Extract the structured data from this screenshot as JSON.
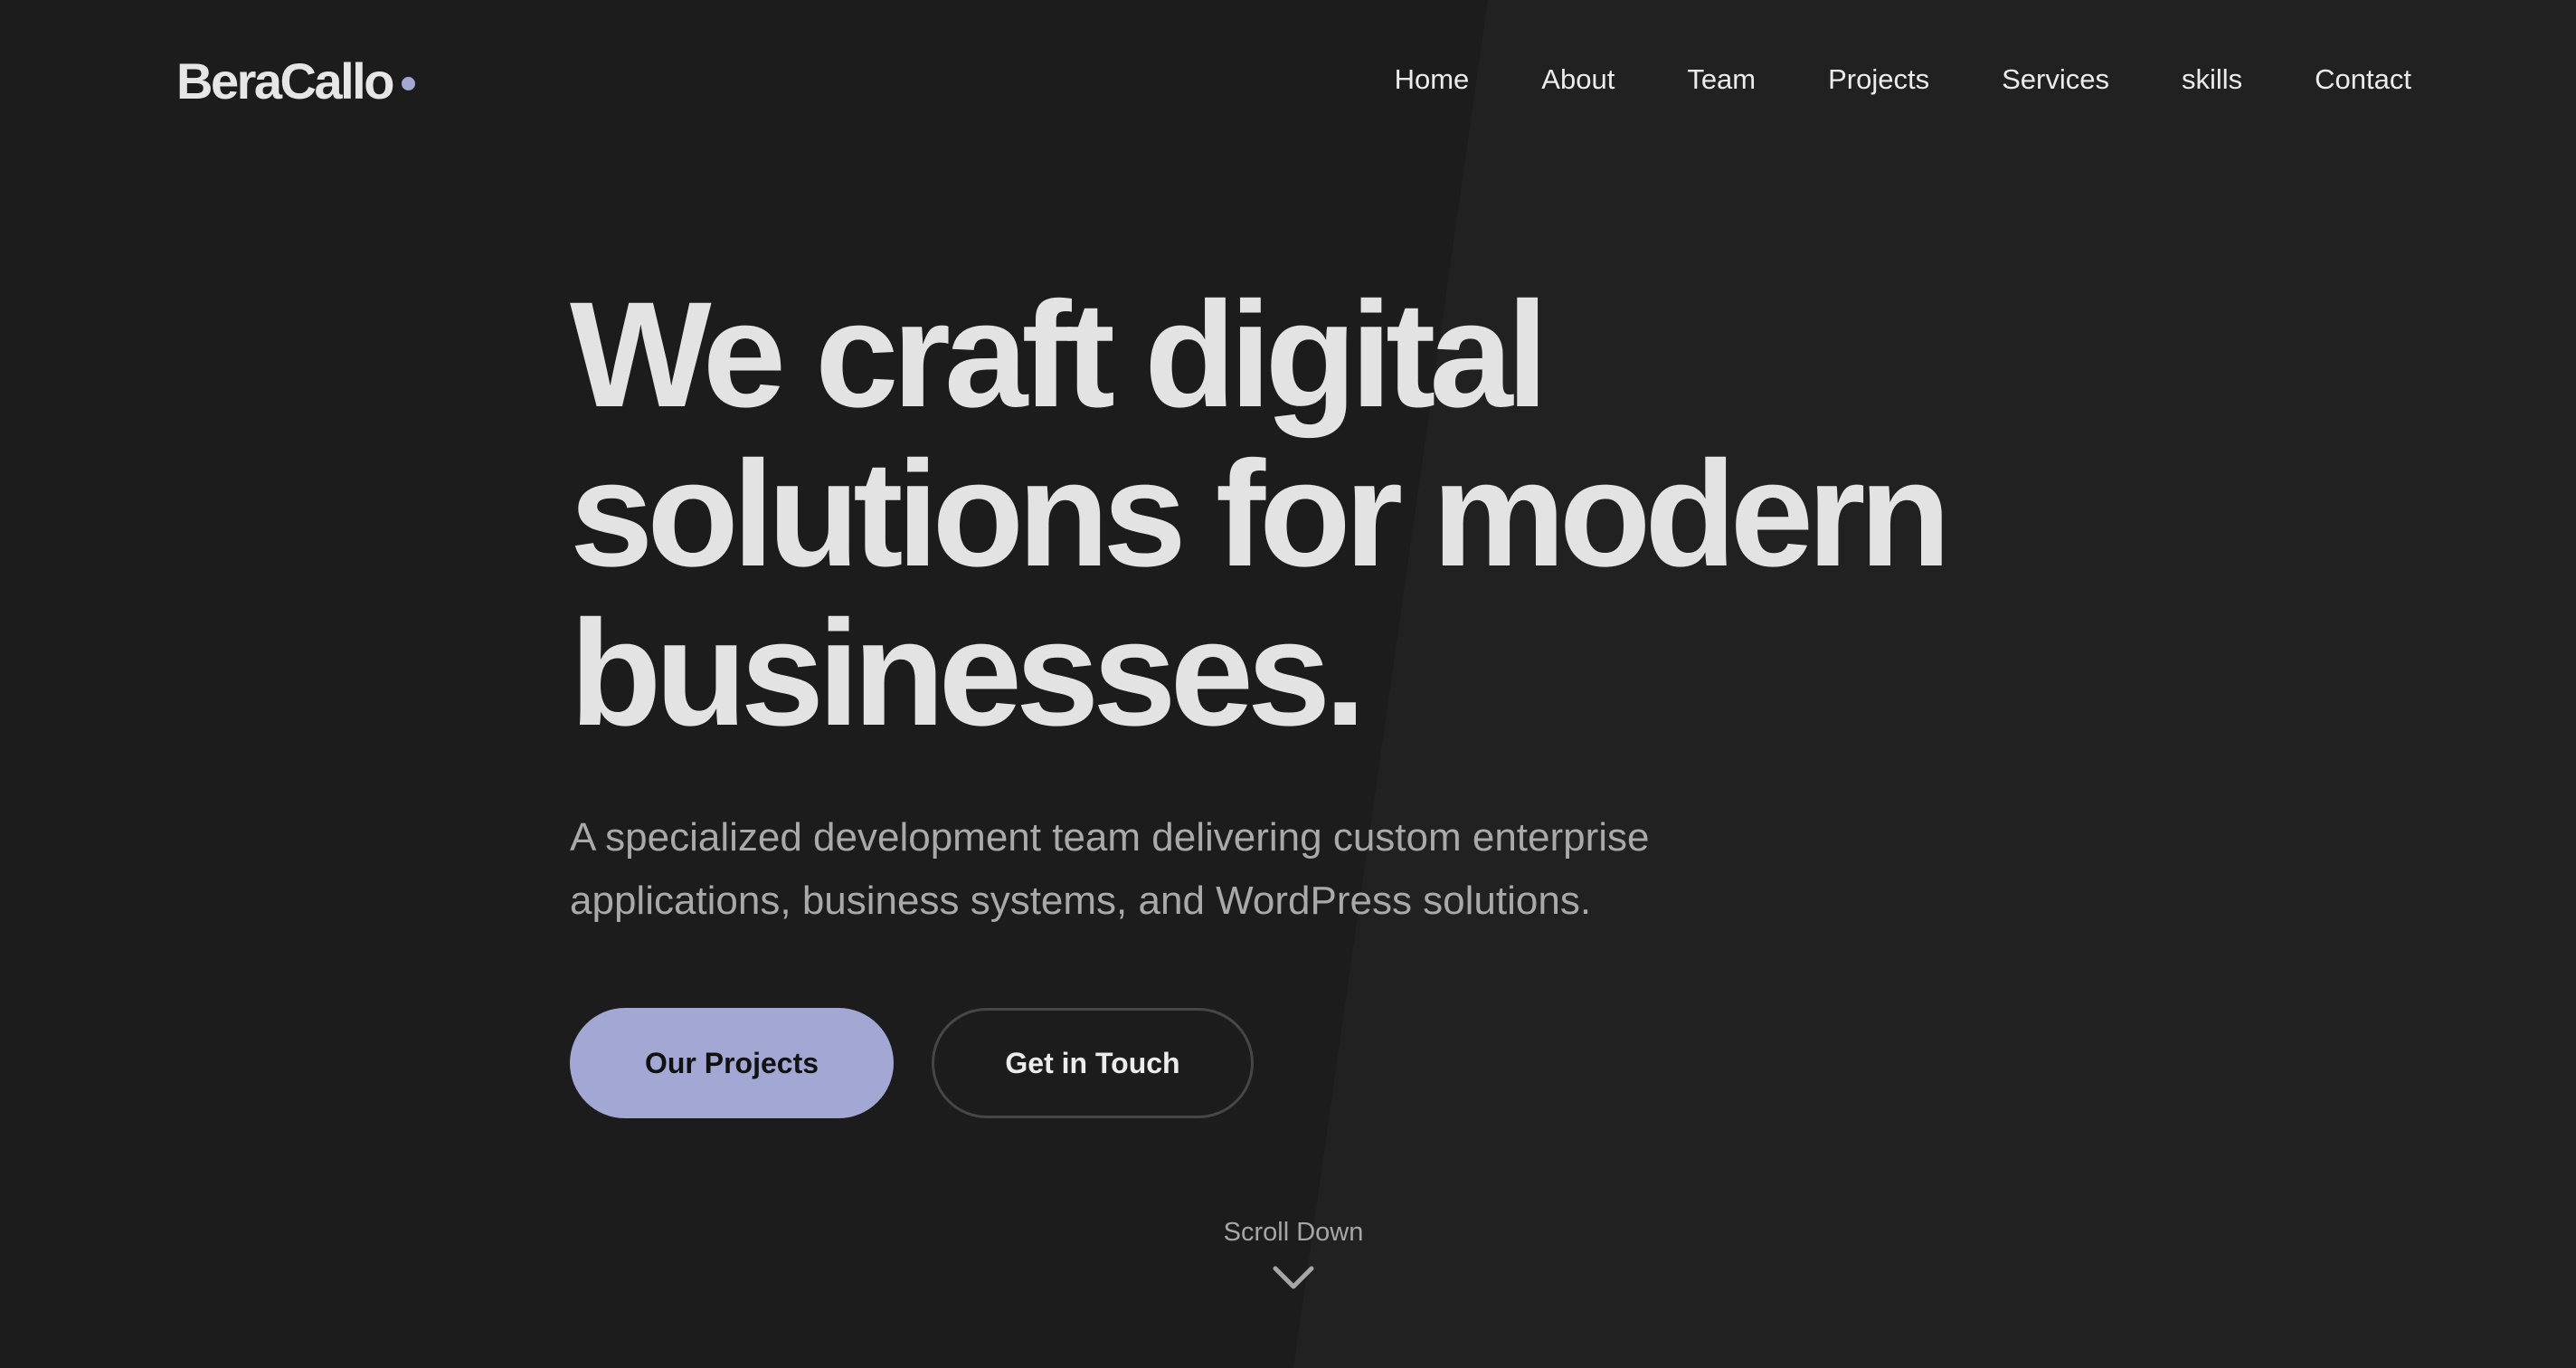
{
  "brand": {
    "name": "BeraCallo",
    "accent_color": "#a3a7d4"
  },
  "nav": {
    "items": [
      {
        "label": "Home"
      },
      {
        "label": "About"
      },
      {
        "label": "Team"
      },
      {
        "label": "Projects"
      },
      {
        "label": "Services"
      },
      {
        "label": "skills"
      },
      {
        "label": "Contact"
      }
    ]
  },
  "hero": {
    "title_lines": [
      "We craft digital",
      "solutions for modern",
      "businesses."
    ],
    "subtitle_lines": [
      "A specialized development team delivering custom enterprise",
      "applications, business systems, and WordPress solutions."
    ],
    "primary_button": "Our Projects",
    "secondary_button": "Get in Touch"
  },
  "scroll": {
    "label": "Scroll Down",
    "icon": "chevron-down-icon"
  },
  "colors": {
    "background": "#1c1c1c",
    "panel": "#212121",
    "accent": "#a3a7d4",
    "text": "#e3e3e3",
    "muted": "#a9a9a9"
  }
}
